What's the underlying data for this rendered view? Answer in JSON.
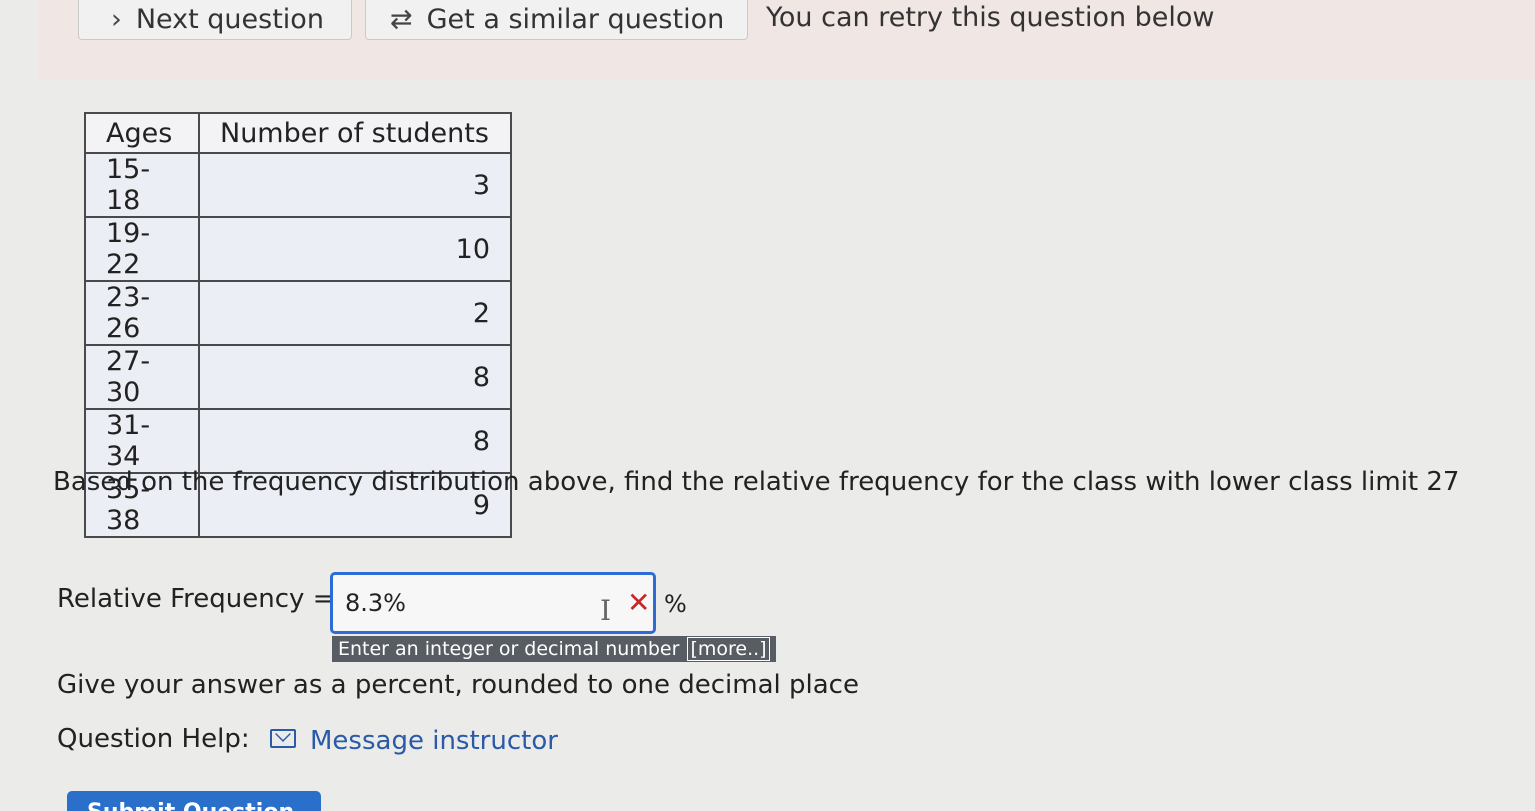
{
  "top_bar": {
    "next_label": "Next question",
    "similar_label": "Get a similar question",
    "retry_text": "You can retry this question below"
  },
  "table": {
    "headers": [
      "Ages",
      "Number of students"
    ],
    "rows": [
      {
        "ages": "15-18",
        "count": "3"
      },
      {
        "ages": "19-22",
        "count": "10"
      },
      {
        "ages": "23-26",
        "count": "2"
      },
      {
        "ages": "27-30",
        "count": "8"
      },
      {
        "ages": "31-34",
        "count": "8"
      },
      {
        "ages": "35-38",
        "count": "9"
      }
    ]
  },
  "question": {
    "prompt": "Based on the frequency distribution above, find the relative frequency for the class with lower class limit 27",
    "rf_label": "Relative Frequency =",
    "answer_value": "8.3%",
    "unit": "%",
    "hint": "Enter an integer or decimal number",
    "hint_more": "[more..]",
    "instruction": "Give your answer as a percent, rounded to one decimal place"
  },
  "help": {
    "label": "Question Help:",
    "message_link": "Message instructor"
  },
  "submit": {
    "label": "Submit Question"
  },
  "icons": {
    "next": "chevron-right-icon",
    "similar": "repeat-icon",
    "clear": "x-icon",
    "mail": "mail-icon"
  },
  "colors": {
    "link": "#2a5aa8",
    "input_border": "#2f6bd6",
    "clear_icon": "#c62828",
    "submit_bg": "#2a6fc9",
    "hint_bg": "#585d63"
  }
}
